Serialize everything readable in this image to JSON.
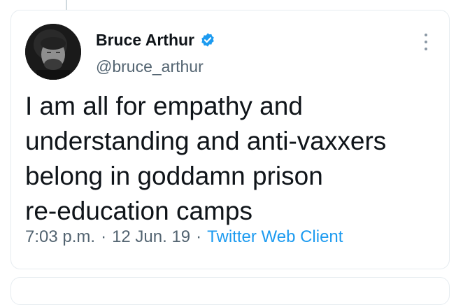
{
  "tweet": {
    "author": {
      "name": "Bruce Arthur",
      "handle": "@bruce_arthur",
      "verified": true,
      "avatar_icon": "person-avatar-icon"
    },
    "text_lines": [
      "I am all for empathy and",
      "understanding and anti-vaxxers",
      "belong in goddamn prison",
      "re-education camps"
    ],
    "time": "7:03 p.m.",
    "date": "12 Jun. 19",
    "separator": "·",
    "client": "Twitter Web Client"
  },
  "colors": {
    "verified": "#1d9bf0",
    "link": "#1d9bf0",
    "secondary_text": "#536471",
    "primary_text": "#0f1419"
  }
}
